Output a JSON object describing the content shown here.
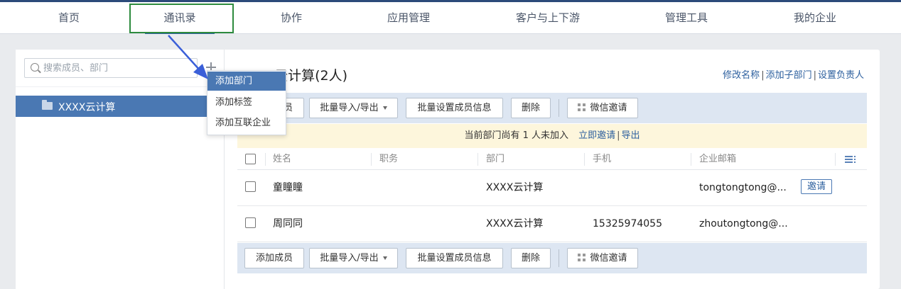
{
  "nav": {
    "items": [
      {
        "label": "首页"
      },
      {
        "label": "通讯录"
      },
      {
        "label": "协作"
      },
      {
        "label": "应用管理"
      },
      {
        "label": "客户与上下游"
      },
      {
        "label": "管理工具"
      },
      {
        "label": "我的企业"
      }
    ],
    "active_index": 1
  },
  "sidebar": {
    "search_placeholder": "搜索成员、部门",
    "add_icon": "plus-icon",
    "tree": [
      {
        "label": "XXXX云计算",
        "icon": "folder-icon",
        "selected": true
      }
    ]
  },
  "dropdown": {
    "items": [
      {
        "label": "添加部门",
        "highlighted": true
      },
      {
        "label": "添加标签"
      },
      {
        "label": "添加互联企业"
      }
    ]
  },
  "main": {
    "title": "XXXX云计算(2人)",
    "links": [
      "修改名称",
      "添加子部门",
      "设置负责人"
    ]
  },
  "toolbar": {
    "add_member": "添加成员",
    "import_export": "批量导入/导出",
    "batch_set": "批量设置成员信息",
    "delete": "删除",
    "wechat_invite": "微信邀请"
  },
  "notice": {
    "text": "当前部门尚有 1 人未加入",
    "invite_now": "立即邀请",
    "export": "导出"
  },
  "table": {
    "headers": [
      "姓名",
      "职务",
      "部门",
      "手机",
      "企业邮箱"
    ],
    "rows": [
      {
        "name": "童瞳瞳",
        "title": "",
        "dept": "XXXX云计算",
        "phone": "",
        "email": "tongtongtong@...",
        "action": "邀请"
      },
      {
        "name": "周同同",
        "title": "",
        "dept": "XXXX云计算",
        "phone": "15325974055",
        "email": "zhoutongtong@...",
        "action": ""
      }
    ]
  },
  "colors": {
    "accent": "#4a78b3",
    "link": "#2c5f9e",
    "toolbar_bg": "#dde6f2",
    "notice_bg": "#fdf6dc",
    "highlight_box": "#2e8b3e",
    "annotation_arrow": "#3a5fd8"
  }
}
